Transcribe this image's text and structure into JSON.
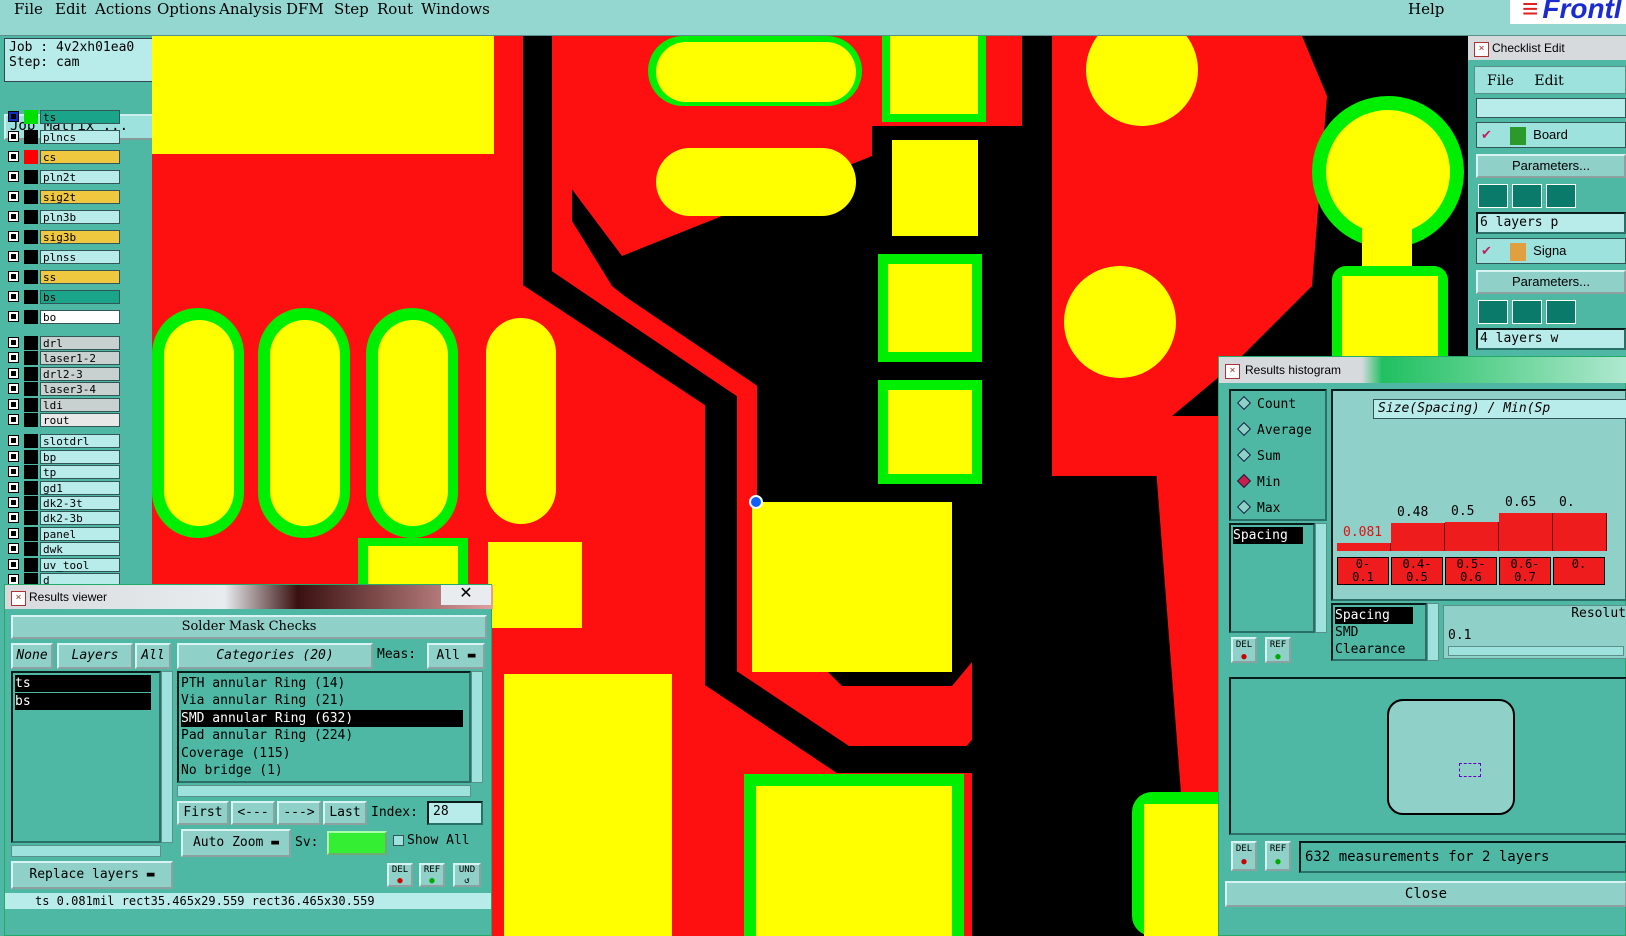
{
  "menubar": {
    "items": [
      "File",
      "Edit",
      "Actions",
      "Options",
      "Analysis",
      "DFM",
      "Step",
      "Rout",
      "Windows"
    ],
    "help": "Help",
    "logo": "Frontl"
  },
  "job": {
    "job_line": "Job : 4v2xh01ea0",
    "step_line": "Step: cam",
    "matrix_button": "Job Matrix ..."
  },
  "layers": [
    {
      "name": "ts",
      "color": "#1aa58a",
      "swatch": "#00e000",
      "selected": true
    },
    {
      "name": "plncs",
      "color": "#b8ecea",
      "swatch": "#000000"
    },
    {
      "name": "cs",
      "color": "#f0c840",
      "swatch": "#ff0000"
    },
    {
      "name": "pln2t",
      "color": "#b8ecea",
      "swatch": "#000000"
    },
    {
      "name": "sig2t",
      "color": "#f0c840",
      "swatch": "#000000"
    },
    {
      "name": "pln3b",
      "color": "#b8ecea",
      "swatch": "#000000"
    },
    {
      "name": "sig3b",
      "color": "#f0c840",
      "swatch": "#000000"
    },
    {
      "name": "plnss",
      "color": "#b8ecea",
      "swatch": "#000000"
    },
    {
      "name": "ss",
      "color": "#f0c840",
      "swatch": "#000000"
    },
    {
      "name": "bs",
      "color": "#1aa58a",
      "swatch": "#000000"
    },
    {
      "name": "bo",
      "color": "#ffffff",
      "swatch": "#000000"
    },
    {
      "name": "drl",
      "color": "#c8d0d0",
      "swatch": "#000000"
    },
    {
      "name": "laser1-2",
      "color": "#c8d0d0",
      "swatch": "#000000"
    },
    {
      "name": "drl2-3",
      "color": "#c8d0d0",
      "swatch": "#000000"
    },
    {
      "name": "laser3-4",
      "color": "#c8d0d0",
      "swatch": "#000000"
    },
    {
      "name": "ldi",
      "color": "#c8d0d0",
      "swatch": "#000000"
    },
    {
      "name": "rout",
      "color": "#e8e8e8",
      "swatch": "#000000"
    },
    {
      "name": "slotdrl",
      "color": "#b8ecea",
      "swatch": "#000000"
    },
    {
      "name": "bp",
      "color": "#b8ecea",
      "swatch": "#000000"
    },
    {
      "name": "tp",
      "color": "#b8ecea",
      "swatch": "#000000"
    },
    {
      "name": "gd1",
      "color": "#b8ecea",
      "swatch": "#000000"
    },
    {
      "name": "dk2-3t",
      "color": "#b8ecea",
      "swatch": "#000000"
    },
    {
      "name": "dk2-3b",
      "color": "#b8ecea",
      "swatch": "#000000"
    },
    {
      "name": "panel",
      "color": "#b8ecea",
      "swatch": "#000000"
    },
    {
      "name": "dwk",
      "color": "#b8ecea",
      "swatch": "#000000"
    },
    {
      "name": "uv_tool",
      "color": "#b8ecea",
      "swatch": "#000000"
    },
    {
      "name": "d",
      "color": "#b8ecea",
      "swatch": "#000000"
    }
  ],
  "results_viewer": {
    "title": "Results viewer",
    "check_name": "Solder Mask Checks",
    "none_btn": "None",
    "layers_btn": "Layers",
    "all_btn": "All",
    "layer_items": [
      "ts",
      "bs"
    ],
    "categories_btn": "Categories (20)",
    "meas_label": "Meas:",
    "meas_value": "All",
    "categories": [
      "PTH annular Ring (14)",
      "Via annular Ring (21)",
      "SMD annular Ring (632)",
      "Pad annular Ring (224)",
      "Coverage (115)",
      "No bridge (1)"
    ],
    "selected_category": 2,
    "nav": {
      "first": "First",
      "prev": "<---",
      "next": "--->",
      "last": "Last",
      "index_label": "Index:",
      "index_value": "28"
    },
    "auto_zoom": "Auto Zoom",
    "sv_label": "Sv:",
    "show_all": "Show All",
    "replace_layers": "Replace layers",
    "del": "DEL",
    "ref": "REF",
    "und": "UND",
    "status_line": "ts 0.081mil  rect35.465x29.559  rect36.465x30.559"
  },
  "checklist": {
    "title": "Checklist Edit",
    "menu": [
      "File",
      "Edit"
    ],
    "item1": "Board",
    "params": "Parameters...",
    "layers1": "6 layers p",
    "item2": "Signa",
    "layers2": "4 layers w"
  },
  "histogram": {
    "title": "Results histogram",
    "modes": [
      "Count",
      "Average",
      "Sum",
      "Min",
      "Max"
    ],
    "selected_mode": "Min",
    "header": "Size(Spacing) / Min(Sp",
    "left_list": [
      "Spacing"
    ],
    "bar_values": [
      "0.081",
      "0.48",
      "0.5",
      "0.65",
      "0."
    ],
    "bar_value_levels": [
      0.12,
      0.45,
      0.46,
      0.6,
      0.6
    ],
    "bin_labels": [
      [
        "0-",
        "0.1"
      ],
      [
        "0.4-",
        "0.5"
      ],
      [
        "0.5-",
        "0.6"
      ],
      [
        "0.6-",
        "0.7"
      ],
      [
        "0.",
        ""
      ]
    ],
    "meas_list": [
      "Spacing",
      "SMD",
      "Clearance"
    ],
    "resolution_label": "Resolut",
    "resolution_value": "0.1",
    "measurements": "632 measurements for 2 layers",
    "close": "Close",
    "del": "DEL",
    "ref": "REF"
  }
}
